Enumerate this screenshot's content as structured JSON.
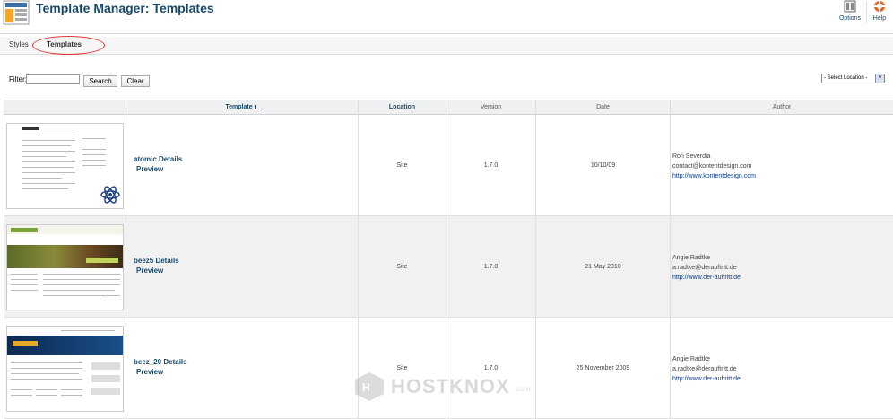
{
  "header": {
    "title": "Template Manager: Templates",
    "options_label": "Options",
    "help_label": "Help"
  },
  "submenu": {
    "tabs": [
      {
        "label": "Styles"
      },
      {
        "label": "Templates"
      }
    ]
  },
  "filter": {
    "label": "Filter:",
    "value": "",
    "search_label": "Search",
    "clear_label": "Clear",
    "location_select": "- Select Location -"
  },
  "table": {
    "columns": [
      "Template",
      "Location",
      "Version",
      "Date",
      "Author"
    ],
    "rows": [
      {
        "name": "atomic Details",
        "preview": "Preview",
        "location": "Site",
        "version": "1.7.0",
        "date": "10/10/09",
        "author": "Ron Severdia",
        "email": "contact@kontentdesign.com",
        "url": "http://www.kontentdesign.com"
      },
      {
        "name": "beez5 Details",
        "preview": "Preview",
        "location": "Site",
        "version": "1.7.0",
        "date": "21 May 2010",
        "author": "Angie Radtke",
        "email": "a.radtke@derauftritt.de",
        "url": "http://www.der-auftritt.de"
      },
      {
        "name": "beez_20 Details",
        "preview": "Preview",
        "location": "Site",
        "version": "1.7.0",
        "date": "25 November 2009",
        "author": "Angie Radtke",
        "email": "a.radtke@derauftritt.de",
        "url": "http://www.der-auftritt.de"
      }
    ]
  },
  "watermark": {
    "text": "HOSTKNOX",
    "suffix": ".com"
  },
  "colors": {
    "title": "#1a4a6b",
    "link": "#0b3c8c",
    "highlight_ring": "#dd3333"
  }
}
